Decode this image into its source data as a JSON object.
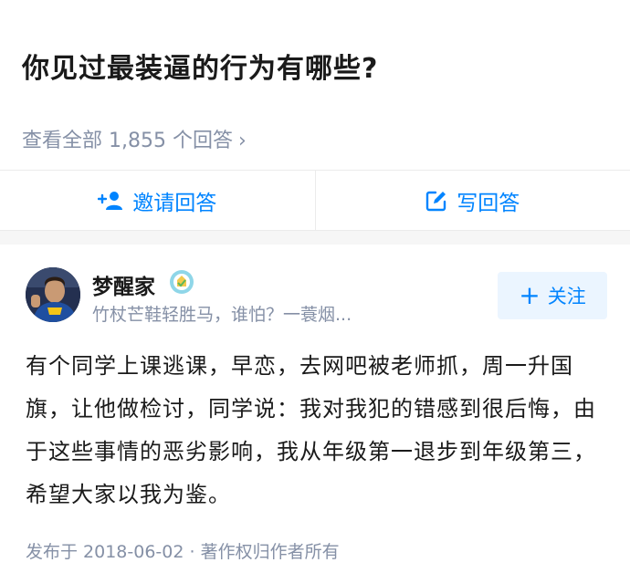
{
  "question": {
    "title": "你见过最装逼的行为有哪些?",
    "view_all": "查看全部 1,855 个回答"
  },
  "actions": {
    "invite_label": "邀请回答",
    "write_label": "写回答"
  },
  "answer": {
    "author_name": "梦醒家",
    "author_bio": "竹杖芒鞋轻胜马，谁怕？一蓑烟...",
    "follow_label": "关注",
    "content": "有个同学上课逃课，早恋，去网吧被老师抓，周一升国旗，让他做检讨，同学说：我对我犯的错感到很后悔，由于这些事情的恶劣影响，我从年级第一退步到年级第三，希望大家以我为鉴。",
    "meta": "发布于 2018-06-02 · 著作权归作者所有"
  },
  "colors": {
    "accent": "#0084ff",
    "secondary_text": "#8590a6",
    "follow_bg": "#ebf5ff"
  },
  "icons": {
    "invite": "add-user-icon",
    "write": "edit-icon",
    "chevron": "chevron-right-icon",
    "badge": "verified-badge-icon"
  }
}
